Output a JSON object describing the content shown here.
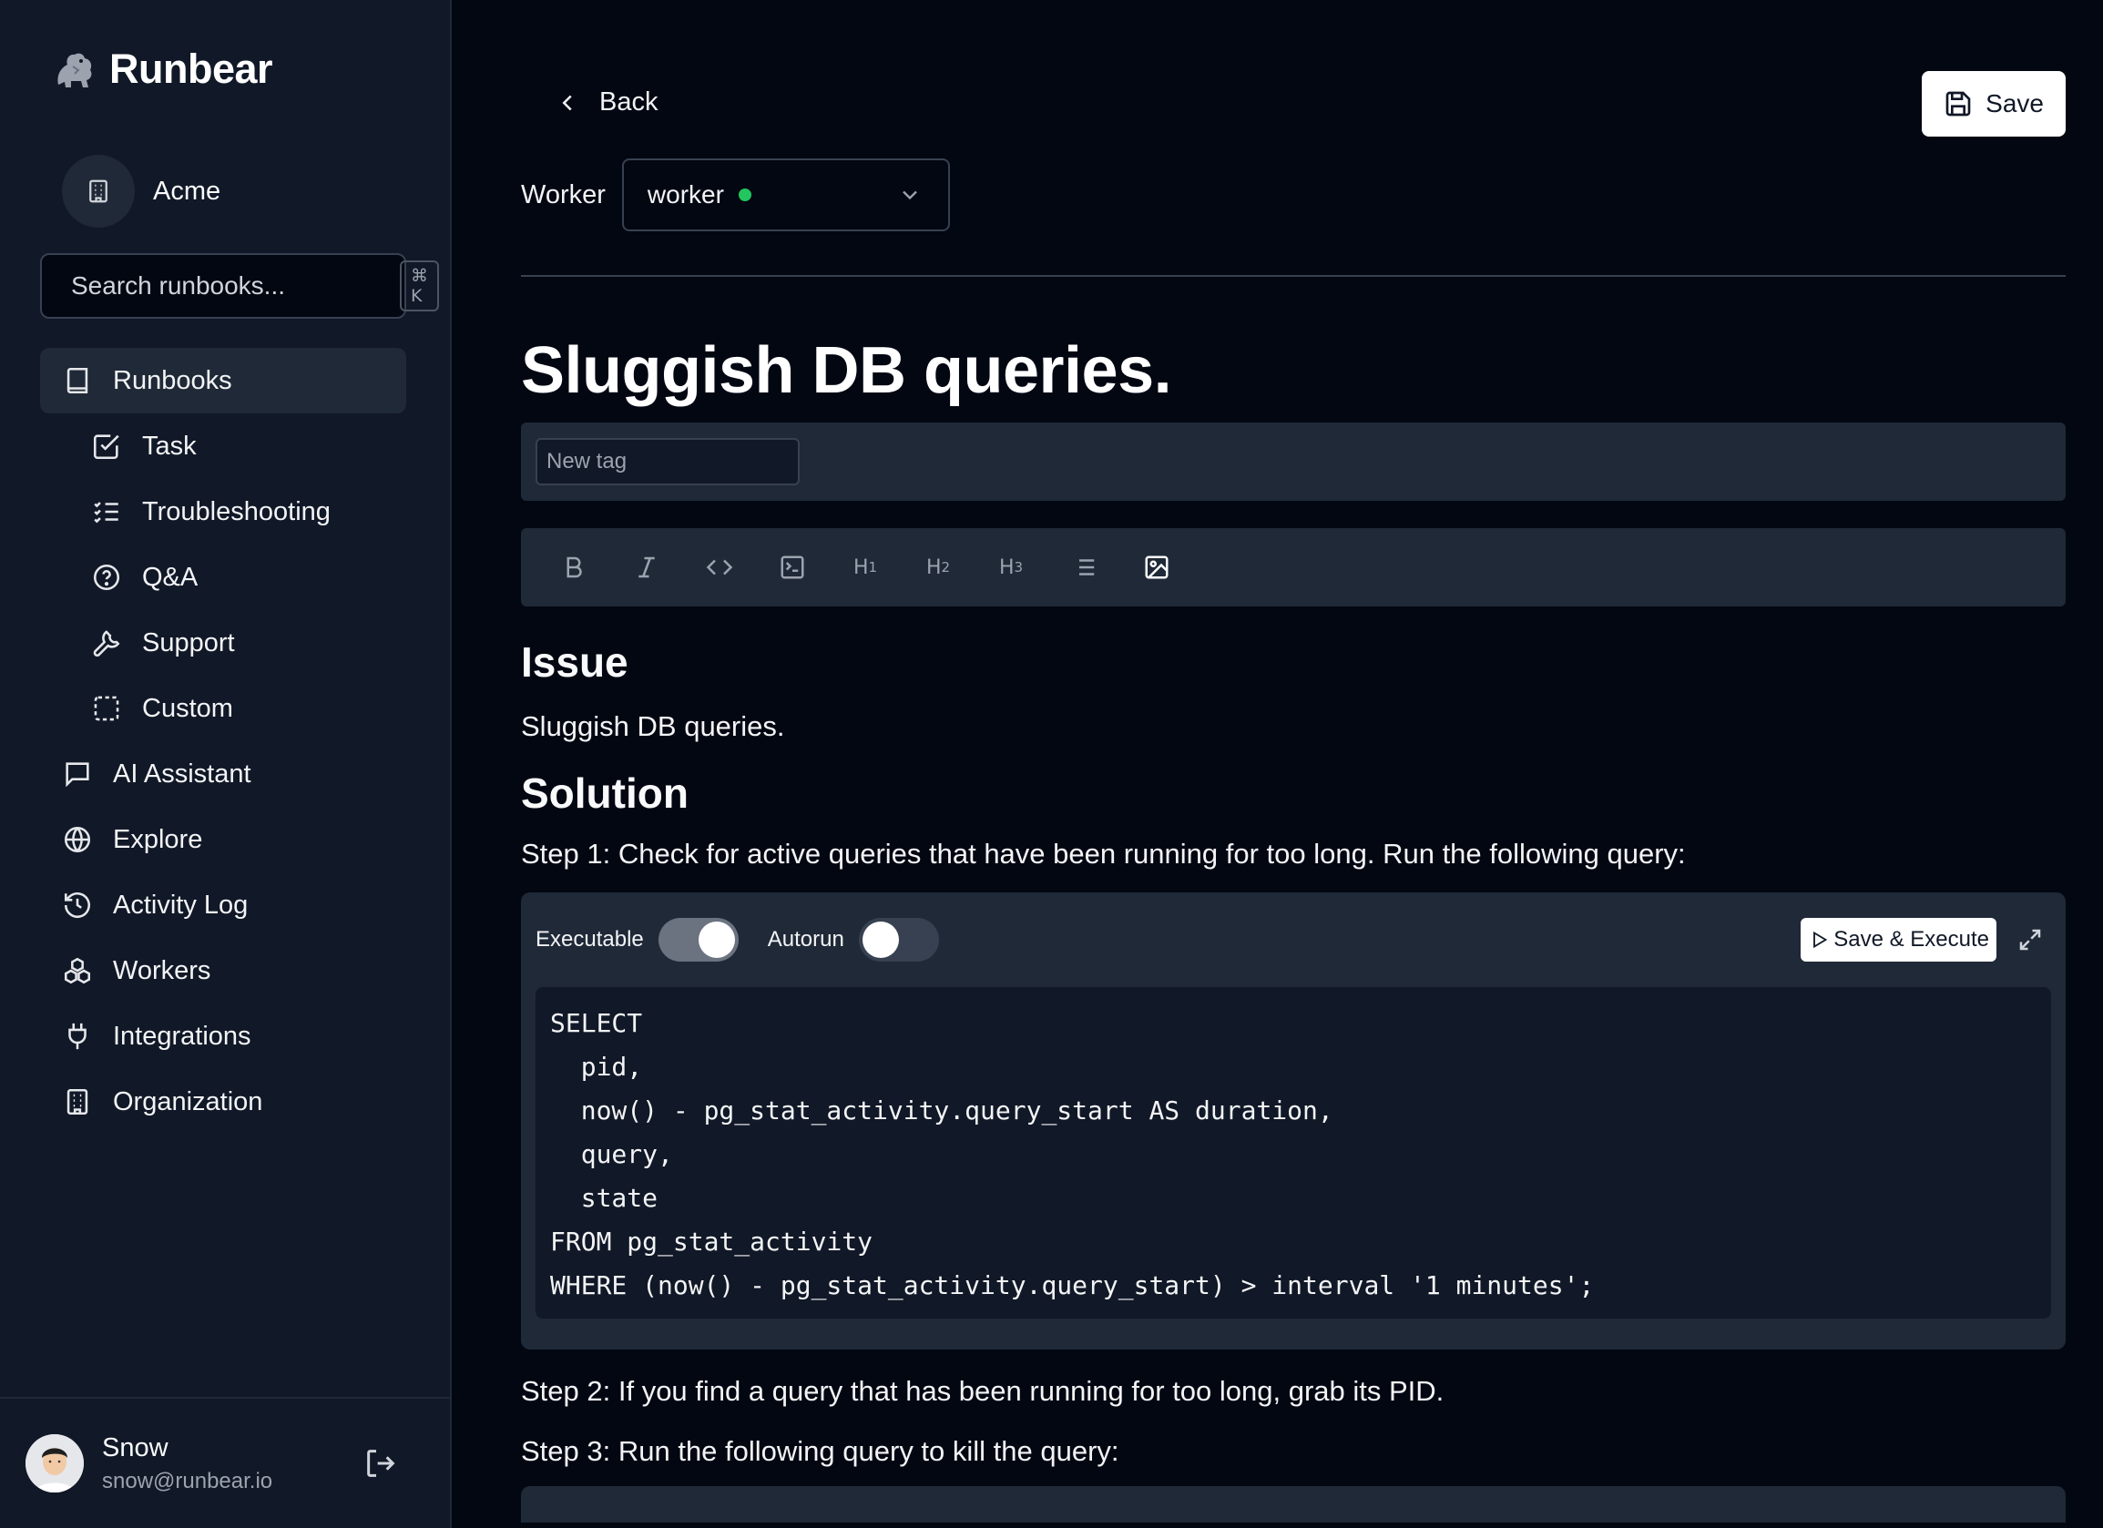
{
  "sidebar": {
    "brand": "Runbear",
    "org_name": "Acme",
    "search_placeholder": "Search runbooks...",
    "search_shortcut": "⌘ K",
    "nav": {
      "runbooks": "Runbooks",
      "task": "Task",
      "troubleshooting": "Troubleshooting",
      "qa": "Q&A",
      "support": "Support",
      "custom": "Custom",
      "ai_assistant": "AI Assistant",
      "explore": "Explore",
      "activity_log": "Activity Log",
      "workers": "Workers",
      "integrations": "Integrations",
      "organization": "Organization"
    },
    "user": {
      "name": "Snow",
      "email": "snow@runbear.io"
    }
  },
  "header": {
    "back_label": "Back",
    "save_label": "Save",
    "worker_label": "Worker",
    "worker_value": "worker",
    "worker_status_color": "#22c55e"
  },
  "doc": {
    "title": "Sluggish DB queries.",
    "tag_placeholder": "New tag",
    "toolbar": {
      "h1": "H",
      "h1_sub": "1",
      "h2": "H",
      "h2_sub": "2",
      "h3": "H",
      "h3_sub": "3"
    },
    "issue_heading": "Issue",
    "issue_text": "Sluggish DB queries.",
    "solution_heading": "Solution",
    "step1": "Step 1: Check for active queries that have been running for too long. Run the following query:",
    "code_block": {
      "executable_label": "Executable",
      "executable_on": true,
      "autorun_label": "Autorun",
      "autorun_on": false,
      "execute_label": "Save & Execute",
      "code": "SELECT\n  pid,\n  now() - pg_stat_activity.query_start AS duration,\n  query,\n  state\nFROM pg_stat_activity\nWHERE (now() - pg_stat_activity.query_start) > interval '1 minutes';"
    },
    "step2": "Step 2: If you find a query that has been running for too long, grab its PID.",
    "step3": "Step 3: Run the following query to kill the query:"
  },
  "colors": {
    "background": "#030712",
    "sidebar": "#111827",
    "panel": "#1f2937",
    "accent_white": "#ffffff"
  }
}
